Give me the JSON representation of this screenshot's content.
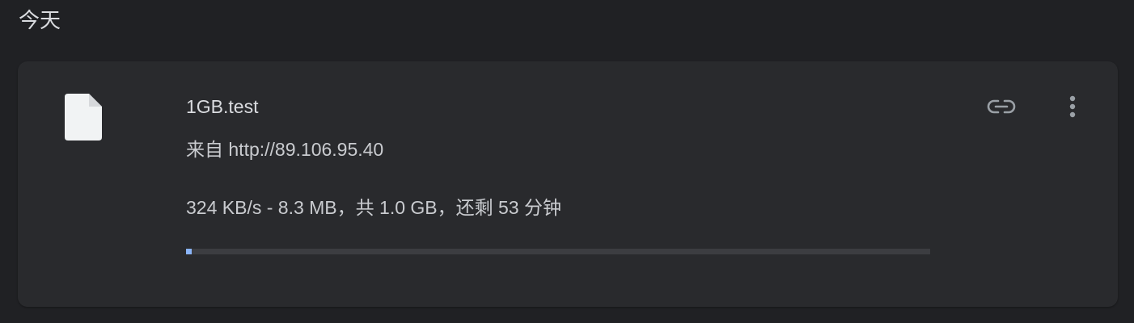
{
  "section": {
    "title": "今天"
  },
  "download": {
    "icon": "file-icon",
    "file_name": "1GB.test",
    "source": "来自 http://89.106.95.40",
    "status": "324 KB/s - 8.3 MB，共 1.0 GB，还剩 53 分钟",
    "progress_fraction": 0.0081,
    "actions": {
      "copy_link_icon": "link-icon",
      "more_icon": "more-vert-icon"
    }
  },
  "colors": {
    "background": "#202124",
    "card": "#292a2d",
    "text_primary": "#dadce0",
    "text_secondary": "#c9cbcf",
    "progress_track": "#3c3d41",
    "progress_fill": "#8ab4f8",
    "icon": "#9aa0a6"
  }
}
